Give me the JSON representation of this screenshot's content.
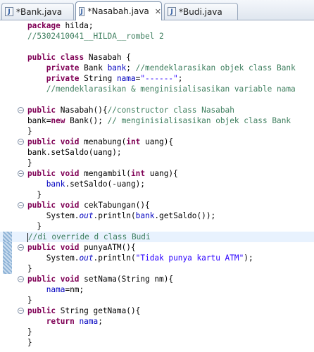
{
  "tabs": [
    {
      "label": "*Bank.java",
      "icon": "java-file-icon",
      "active": false
    },
    {
      "label": "*Nasabah.java",
      "icon": "java-file-icon",
      "active": true,
      "close": "✕"
    },
    {
      "label": "*Budi.java",
      "icon": "java-file-icon",
      "active": false
    }
  ],
  "java_icon_letter": "J",
  "code": {
    "l1": "hilda;",
    "l2": "//5302410041__HILDA__rombel 2",
    "l4_class": "Nasabah {",
    "l5_type": "Bank ",
    "l5_var": "bank",
    "l5_cm": "//mendeklarasikan objek class Bank",
    "l6_type": "String ",
    "l6_var": "nama",
    "l6_str": "\"------\"",
    "l7_cm": "//mendeklarasikan & menginisialisasikan variable nama",
    "l9_a": "Nasabah(){",
    "l9_cm": "//constructor class Nasabah",
    "l10_a": "bank=",
    "l10_b": "Bank(); ",
    "l10_cm": "// menginisialisasikan objek class Bank",
    "l12_a": "menabung(",
    "l12_b": " uang){",
    "l13": "bank.setSaldo(uang);",
    "l15_a": "mengambil(",
    "l15_b": " uang){",
    "l16_a": "bank",
    "l16_b": ".setSaldo(-uang);",
    "l18_a": "cekTabungan(){",
    "l19_a": "System.",
    "l19_out": "out",
    "l19_b": ".println(",
    "l19_c": "bank",
    "l19_d": ".getSaldo());",
    "l21_cm": "//di override d class Budi",
    "l22_a": "punyaATM(){",
    "l23_str": "\"Tidak punya kartu ATM\"",
    "l23_end": ");",
    "l25_a": "setNama(String nm){",
    "l26_var": "nama",
    "l26_b": "=nm;",
    "l28_a": "String getNama(){",
    "l29_var": "nama",
    "l29_b": ";",
    "close_brace": "}",
    "kw": {
      "package": "package",
      "public": "public",
      "class": "class",
      "private": "private",
      "new": "new",
      "void": "void",
      "int": "int",
      "return": "return"
    }
  }
}
